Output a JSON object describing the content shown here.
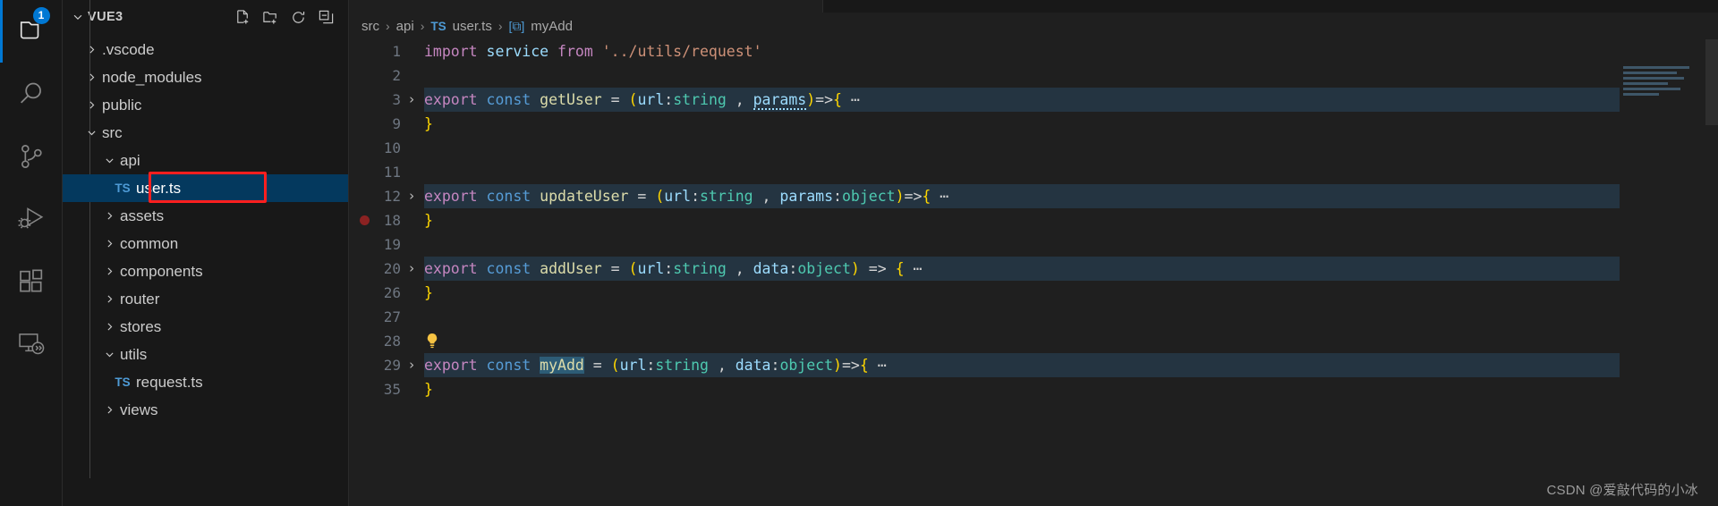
{
  "activitybar": {
    "items": [
      {
        "name": "explorer",
        "icon": "files-icon",
        "badge": "1",
        "active": true
      },
      {
        "name": "search",
        "icon": "search-icon",
        "badge": "",
        "active": false
      },
      {
        "name": "source-control",
        "icon": "source-control-icon",
        "badge": "",
        "active": false
      },
      {
        "name": "run-and-debug",
        "icon": "run-debug-icon",
        "badge": "",
        "active": false
      },
      {
        "name": "extensions",
        "icon": "extensions-icon",
        "badge": "",
        "active": false
      },
      {
        "name": "remote-explorer",
        "icon": "remote-explorer-icon",
        "badge": "",
        "active": false
      }
    ]
  },
  "sidebar": {
    "title": "VUE3",
    "actions": [
      {
        "name": "new-file",
        "icon": "new-file-icon"
      },
      {
        "name": "new-folder",
        "icon": "new-folder-icon"
      },
      {
        "name": "refresh",
        "icon": "refresh-icon"
      },
      {
        "name": "collapse-all",
        "icon": "collapse-all-icon"
      }
    ],
    "tree": [
      {
        "label": ".vscode",
        "type": "folder",
        "state": "collapsed",
        "depth": 1
      },
      {
        "label": "node_modules",
        "type": "folder",
        "state": "collapsed",
        "depth": 1
      },
      {
        "label": "public",
        "type": "folder",
        "state": "collapsed",
        "depth": 1
      },
      {
        "label": "src",
        "type": "folder",
        "state": "expanded",
        "depth": 1
      },
      {
        "label": "api",
        "type": "folder",
        "state": "expanded",
        "depth": 2
      },
      {
        "label": "user.ts",
        "type": "file-ts",
        "state": "selected",
        "depth": 3
      },
      {
        "label": "assets",
        "type": "folder",
        "state": "collapsed",
        "depth": 2
      },
      {
        "label": "common",
        "type": "folder",
        "state": "collapsed",
        "depth": 2
      },
      {
        "label": "components",
        "type": "folder",
        "state": "collapsed",
        "depth": 2
      },
      {
        "label": "router",
        "type": "folder",
        "state": "collapsed",
        "depth": 2
      },
      {
        "label": "stores",
        "type": "folder",
        "state": "collapsed",
        "depth": 2
      },
      {
        "label": "utils",
        "type": "folder",
        "state": "expanded",
        "depth": 2
      },
      {
        "label": "request.ts",
        "type": "file-ts",
        "state": "normal",
        "depth": 3
      },
      {
        "label": "views",
        "type": "folder",
        "state": "collapsed",
        "depth": 2
      }
    ]
  },
  "breadcrumb": {
    "parts": [
      {
        "text": "src",
        "kind": "folder"
      },
      {
        "text": "api",
        "kind": "folder"
      },
      {
        "text": "user.ts",
        "kind": "file-ts"
      },
      {
        "text": "myAdd",
        "kind": "symbol"
      }
    ],
    "separator": "›",
    "ts_badge": "TS",
    "symbol_badge": "[⧉]"
  },
  "editor": {
    "filename": "user.ts",
    "lines": [
      {
        "num": "1",
        "fold": "",
        "folded": false,
        "breakpoint": false,
        "bulb": false,
        "tokens": [
          {
            "t": "import ",
            "c": "t-kw"
          },
          {
            "t": "service ",
            "c": "t-param"
          },
          {
            "t": "from ",
            "c": "t-kw"
          },
          {
            "t": "'../utils/request'",
            "c": "t-str"
          }
        ]
      },
      {
        "num": "2",
        "fold": "",
        "folded": false,
        "breakpoint": false,
        "bulb": false,
        "tokens": []
      },
      {
        "num": "3",
        "fold": "›",
        "folded": true,
        "breakpoint": false,
        "bulb": false,
        "tokens": [
          {
            "t": "export ",
            "c": "t-kw"
          },
          {
            "t": "const ",
            "c": "t-kw2"
          },
          {
            "t": "getUser",
            "c": "t-fn"
          },
          {
            "t": " = ",
            "c": "t-op"
          },
          {
            "t": "(",
            "c": "t-paren"
          },
          {
            "t": "url",
            "c": "t-param"
          },
          {
            "t": ":",
            "c": "t-op"
          },
          {
            "t": "string",
            "c": "t-type"
          },
          {
            "t": " , ",
            "c": "t-op"
          },
          {
            "t": "params",
            "c": "t-param",
            "squiggle": true
          },
          {
            "t": ")",
            "c": "t-paren"
          },
          {
            "t": "=>",
            "c": "t-op"
          },
          {
            "t": "{",
            "c": "t-brace"
          },
          {
            "t": " ⋯",
            "c": "t-dots"
          }
        ]
      },
      {
        "num": "9",
        "fold": "",
        "folded": false,
        "breakpoint": false,
        "bulb": false,
        "tokens": [
          {
            "t": "}",
            "c": "t-brace"
          }
        ]
      },
      {
        "num": "10",
        "fold": "",
        "folded": false,
        "breakpoint": false,
        "bulb": false,
        "tokens": []
      },
      {
        "num": "11",
        "fold": "",
        "folded": false,
        "breakpoint": false,
        "bulb": false,
        "tokens": []
      },
      {
        "num": "12",
        "fold": "›",
        "folded": true,
        "breakpoint": false,
        "bulb": false,
        "tokens": [
          {
            "t": "export ",
            "c": "t-kw"
          },
          {
            "t": "const ",
            "c": "t-kw2"
          },
          {
            "t": "updateUser",
            "c": "t-fn"
          },
          {
            "t": " = ",
            "c": "t-op"
          },
          {
            "t": "(",
            "c": "t-paren"
          },
          {
            "t": "url",
            "c": "t-param"
          },
          {
            "t": ":",
            "c": "t-op"
          },
          {
            "t": "string",
            "c": "t-type"
          },
          {
            "t": " , ",
            "c": "t-op"
          },
          {
            "t": "params",
            "c": "t-param"
          },
          {
            "t": ":",
            "c": "t-op"
          },
          {
            "t": "object",
            "c": "t-type"
          },
          {
            "t": ")",
            "c": "t-paren"
          },
          {
            "t": "=>",
            "c": "t-op"
          },
          {
            "t": "{",
            "c": "t-brace"
          },
          {
            "t": " ⋯",
            "c": "t-dots"
          }
        ]
      },
      {
        "num": "18",
        "fold": "",
        "folded": false,
        "breakpoint": true,
        "bulb": false,
        "tokens": [
          {
            "t": "}",
            "c": "t-brace"
          }
        ]
      },
      {
        "num": "19",
        "fold": "",
        "folded": false,
        "breakpoint": false,
        "bulb": false,
        "tokens": []
      },
      {
        "num": "20",
        "fold": "›",
        "folded": true,
        "breakpoint": false,
        "bulb": false,
        "tokens": [
          {
            "t": "export ",
            "c": "t-kw"
          },
          {
            "t": "const ",
            "c": "t-kw2"
          },
          {
            "t": "addUser",
            "c": "t-fn"
          },
          {
            "t": " = ",
            "c": "t-op"
          },
          {
            "t": "(",
            "c": "t-paren"
          },
          {
            "t": "url",
            "c": "t-param"
          },
          {
            "t": ":",
            "c": "t-op"
          },
          {
            "t": "string",
            "c": "t-type"
          },
          {
            "t": " , ",
            "c": "t-op"
          },
          {
            "t": "data",
            "c": "t-param"
          },
          {
            "t": ":",
            "c": "t-op"
          },
          {
            "t": "object",
            "c": "t-type"
          },
          {
            "t": ")",
            "c": "t-paren"
          },
          {
            "t": " => ",
            "c": "t-op"
          },
          {
            "t": "{",
            "c": "t-brace"
          },
          {
            "t": " ⋯",
            "c": "t-dots"
          }
        ]
      },
      {
        "num": "26",
        "fold": "",
        "folded": false,
        "breakpoint": false,
        "bulb": false,
        "tokens": [
          {
            "t": "}",
            "c": "t-brace"
          }
        ]
      },
      {
        "num": "27",
        "fold": "",
        "folded": false,
        "breakpoint": false,
        "bulb": false,
        "tokens": []
      },
      {
        "num": "28",
        "fold": "",
        "folded": false,
        "breakpoint": false,
        "bulb": true,
        "tokens": []
      },
      {
        "num": "29",
        "fold": "›",
        "folded": true,
        "breakpoint": false,
        "bulb": false,
        "tokens": [
          {
            "t": "export ",
            "c": "t-kw"
          },
          {
            "t": "const ",
            "c": "t-kw2"
          },
          {
            "t": "myAdd",
            "c": "t-fn",
            "selected": true
          },
          {
            "t": " = ",
            "c": "t-op"
          },
          {
            "t": "(",
            "c": "t-paren"
          },
          {
            "t": "url",
            "c": "t-param"
          },
          {
            "t": ":",
            "c": "t-op"
          },
          {
            "t": "string",
            "c": "t-type"
          },
          {
            "t": " , ",
            "c": "t-op"
          },
          {
            "t": "data",
            "c": "t-param"
          },
          {
            "t": ":",
            "c": "t-op"
          },
          {
            "t": "object",
            "c": "t-type"
          },
          {
            "t": ")",
            "c": "t-paren"
          },
          {
            "t": "=>",
            "c": "t-op"
          },
          {
            "t": "{",
            "c": "t-brace"
          },
          {
            "t": " ⋯",
            "c": "t-dots"
          }
        ]
      },
      {
        "num": "35",
        "fold": "",
        "folded": false,
        "breakpoint": false,
        "bulb": false,
        "tokens": [
          {
            "t": "}",
            "c": "t-brace"
          }
        ]
      }
    ]
  },
  "watermark": {
    "text": "CSDN @爱敲代码的小冰"
  },
  "colors": {
    "accent": "#0078d4",
    "selection_blue": "#04395e",
    "annotation_red": "#ff1f1f",
    "folded_region": "#243441",
    "breakpoint": "#8b2222",
    "editor_bg": "#1f1f1f",
    "sidebar_bg": "#181818"
  }
}
